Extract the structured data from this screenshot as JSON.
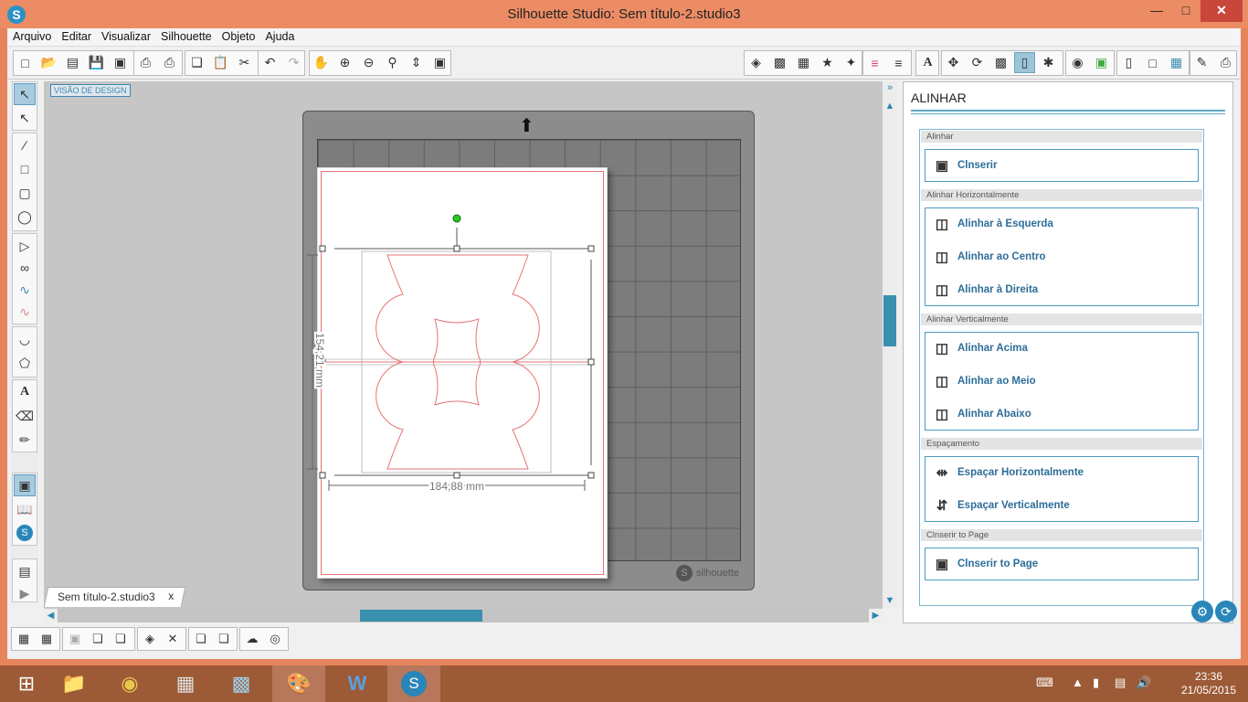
{
  "window": {
    "title": "Silhouette Studio: Sem título-2.studio3",
    "min": "—",
    "max": "□",
    "close": "✕"
  },
  "menu": [
    "Arquivo",
    "Editar",
    "Visualizar",
    "Silhouette",
    "Objeto",
    "Ajuda"
  ],
  "canvas": {
    "design_label": "VISÃO DE DESIGN",
    "width_label": "184,88 mm",
    "height_label": "154,21 mm",
    "mat_brand": "silhouette"
  },
  "document_tab": {
    "label": "Sem título-2.studio3",
    "close": "x"
  },
  "panel": {
    "title": "ALINHAR",
    "sections": [
      {
        "header": "Alinhar",
        "buttons": [
          {
            "label": "Clnserir",
            "icon": "center-align-icon"
          }
        ]
      },
      {
        "header": "Alinhar Horizontalmente",
        "buttons": [
          {
            "label": "Alinhar à Esquerda",
            "icon": "align-left-icon"
          },
          {
            "label": "Alinhar ao Centro",
            "icon": "align-center-icon"
          },
          {
            "label": "Alinhar à Direita",
            "icon": "align-right-icon"
          }
        ]
      },
      {
        "header": "Alinhar Verticalmente",
        "buttons": [
          {
            "label": "Alinhar Acima",
            "icon": "align-top-icon"
          },
          {
            "label": "Alinhar ao Meio",
            "icon": "align-middle-icon"
          },
          {
            "label": "Alinhar Abaixo",
            "icon": "align-bottom-icon"
          }
        ]
      },
      {
        "header": "Espaçamento",
        "buttons": [
          {
            "label": "Espaçar Horizontalmente",
            "icon": "space-horizontal-icon"
          },
          {
            "label": "Espaçar Verticalmente",
            "icon": "space-vertical-icon"
          }
        ]
      },
      {
        "header": "Clnserir to Page",
        "buttons": [
          {
            "label": "Clnserir to Page",
            "icon": "center-to-page-icon"
          }
        ]
      }
    ]
  },
  "taskbar": {
    "time": "23:36",
    "date": "21/05/2015"
  },
  "colors": {
    "accent": "#3b8fae",
    "titlebar": "#ec8c64",
    "cut_line": "#e57373",
    "taskbar": "#9d5a36"
  }
}
